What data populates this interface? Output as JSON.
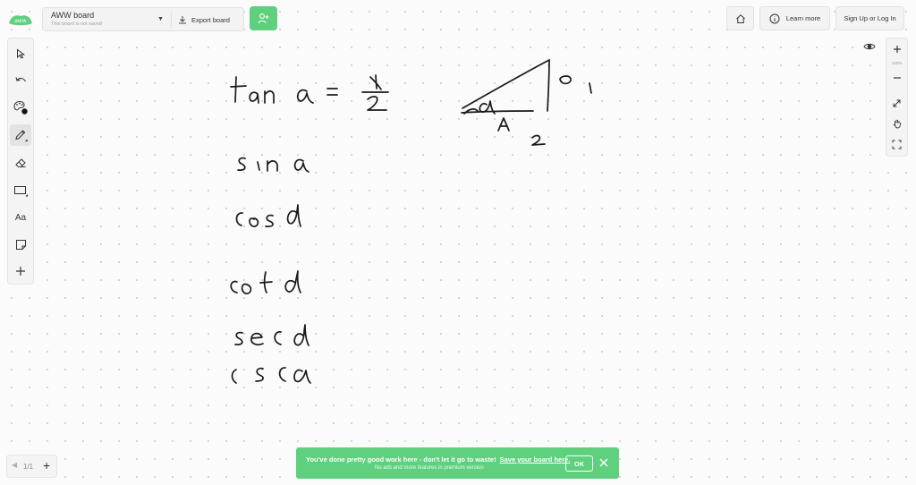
{
  "app": {
    "board_name": "AWW board",
    "board_status": "This board is not saved",
    "export_label": "Export board",
    "learn_more_label": "Learn more",
    "signup_label": "Sign Up or Log In"
  },
  "toolbar": {
    "text_tool_label": "Aa"
  },
  "zoom": {
    "level": "100%"
  },
  "pages": {
    "label": "1/1"
  },
  "banner": {
    "message": "You've done pretty good work here - don't let it go to waste!",
    "link": "Save your board here.",
    "sub": "No ads and more features in premium version",
    "ok_label": "OK"
  },
  "colors": {
    "accent": "#5fd07e",
    "ink": "#1a1a1a",
    "panel": "#f4f4f4"
  },
  "icons": [
    "logo-icon",
    "download-icon",
    "add-user-icon",
    "home-icon",
    "info-icon",
    "pointer-icon",
    "undo-icon",
    "palette-icon",
    "pencil-icon",
    "eraser-icon",
    "rectangle-icon",
    "sticky-note-icon",
    "plus-icon",
    "eye-icon",
    "zoom-in-icon",
    "zoom-out-icon",
    "fit-screen-icon",
    "hand-icon",
    "fullscreen-icon",
    "chevron-left-icon",
    "close-icon"
  ]
}
